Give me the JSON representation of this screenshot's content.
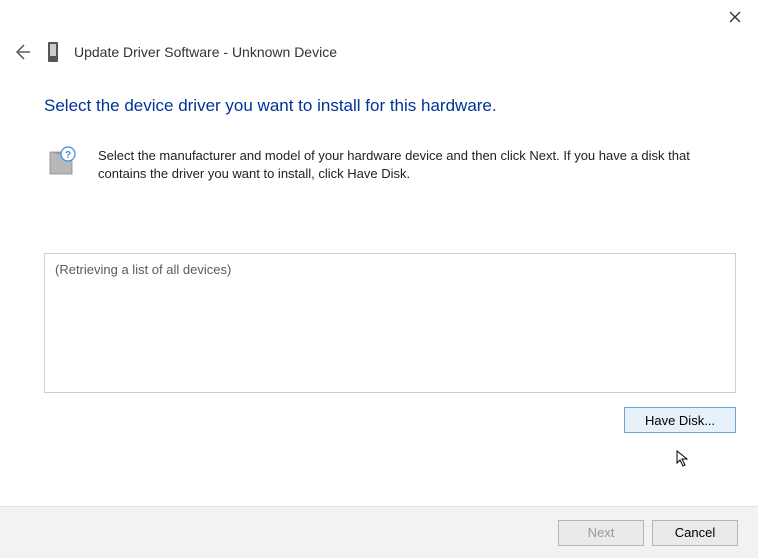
{
  "window": {
    "title": "Update Driver Software - Unknown Device"
  },
  "heading": "Select the device driver you want to install for this hardware.",
  "instruction": "Select the manufacturer and model of your hardware device and then click Next. If you have a disk that contains the driver you want to install, click Have Disk.",
  "listBox": {
    "statusText": "(Retrieving a list of all devices)"
  },
  "buttons": {
    "haveDisk": "Have Disk...",
    "next": "Next",
    "cancel": "Cancel"
  }
}
